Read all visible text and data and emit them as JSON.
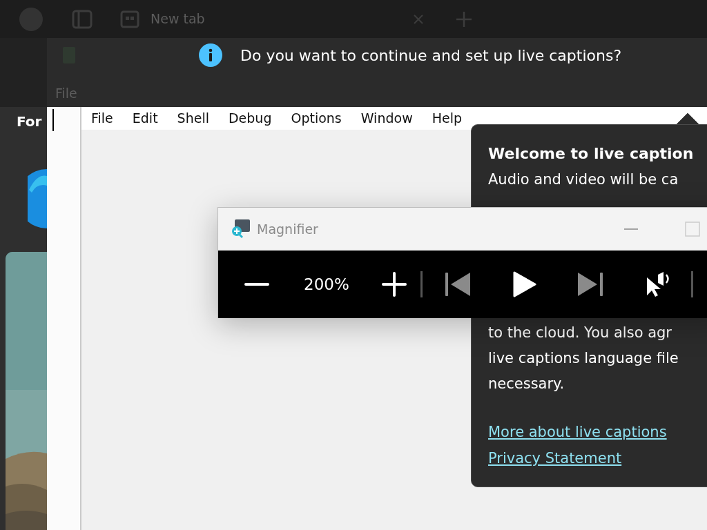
{
  "browser": {
    "tabs": [
      {
        "label": "New tab"
      }
    ]
  },
  "background_window": {
    "menu_label": "File"
  },
  "desktop": {
    "search_label": "For"
  },
  "captions_prompt": {
    "message": "Do you want to continue and set up live captions?"
  },
  "editor": {
    "menu": [
      "File",
      "Edit",
      "Shell",
      "Debug",
      "Options",
      "Window",
      "Help"
    ]
  },
  "flyout": {
    "title": "Welcome to live caption",
    "top_lines": [
      "Audio and video will be ca"
    ],
    "bottom_lines": [
      "to the cloud. You also agr",
      "live captions language file",
      "necessary."
    ],
    "links": [
      "More about live captions",
      "Privacy Statement"
    ]
  },
  "magnifier": {
    "title": "Magnifier",
    "zoom_level": "200%",
    "playback": [
      {
        "kind": "previous",
        "disabled": true
      },
      {
        "kind": "play",
        "disabled": false
      },
      {
        "kind": "next",
        "disabled": true
      }
    ]
  }
}
